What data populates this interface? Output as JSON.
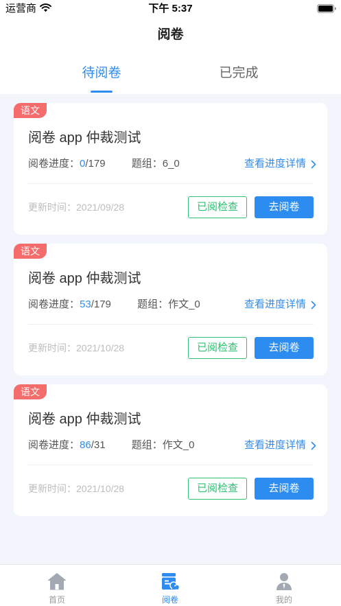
{
  "status_bar": {
    "carrier": "运营商",
    "time": "下午 5:37",
    "wifi_icon": "wifi-icon",
    "battery_icon": "battery-icon"
  },
  "nav": {
    "title": "阅卷"
  },
  "tabs": [
    {
      "label": "待阅卷",
      "active": true
    },
    {
      "label": "已完成",
      "active": false
    }
  ],
  "cards": [
    {
      "subject": "语文",
      "title": "阅卷 app 仲裁测试",
      "progress_label": "阅卷进度：",
      "progress_done": "0",
      "progress_total": "/179",
      "group_label": "题组：",
      "group": "6_0",
      "detail_link": "查看进度详情",
      "updated_label": "更新时间：",
      "updated": "2021/09/28",
      "check_button": "已阅检查",
      "grade_button": "去阅卷"
    },
    {
      "subject": "语文",
      "title": "阅卷 app 仲裁测试",
      "progress_label": "阅卷进度：",
      "progress_done": "53",
      "progress_total": "/179",
      "group_label": "题组：",
      "group": "作文_0",
      "detail_link": "查看进度详情",
      "updated_label": "更新时间：",
      "updated": "2021/10/28",
      "check_button": "已阅检查",
      "grade_button": "去阅卷"
    },
    {
      "subject": "语文",
      "title": "阅卷 app 仲裁测试",
      "progress_label": "阅卷进度：",
      "progress_done": "86",
      "progress_total": "/31",
      "group_label": "题组：",
      "group": "作文_0",
      "detail_link": "查看进度详情",
      "updated_label": "更新时间：",
      "updated": "2021/10/28",
      "check_button": "已阅检查",
      "grade_button": "去阅卷"
    }
  ],
  "bottom_nav": [
    {
      "label": "首页",
      "icon": "home-icon",
      "active": false
    },
    {
      "label": "阅卷",
      "icon": "grading-icon",
      "active": true
    },
    {
      "label": "我的",
      "icon": "profile-icon",
      "active": false
    }
  ],
  "colors": {
    "primary": "#2d8cf0",
    "subject_tag": "#f56c6c",
    "check_button": "#2fbf71",
    "page_background": "#f2f5fb",
    "muted_text": "#bdbdbd"
  }
}
